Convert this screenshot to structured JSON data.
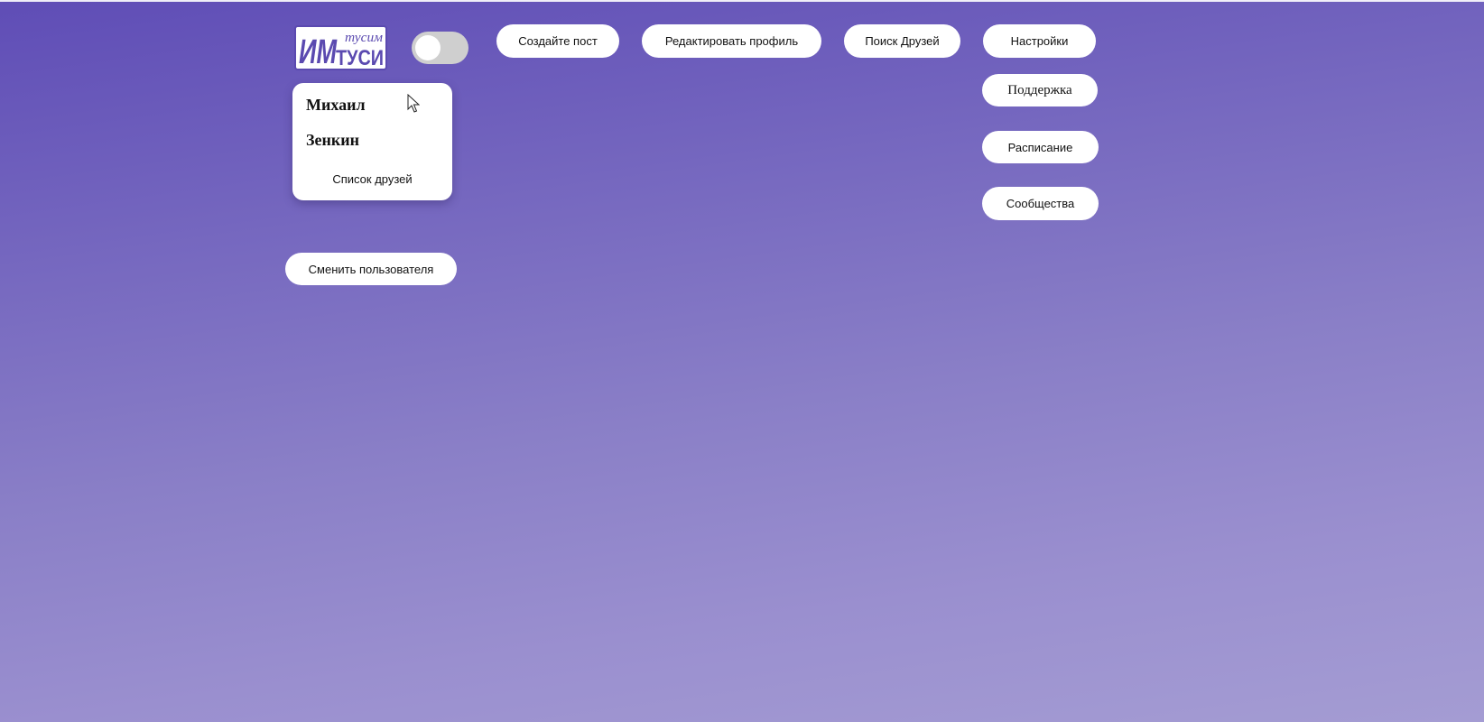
{
  "logo": {
    "main_text": "ТУСИ",
    "sub_text": "тусим",
    "monogram": "ИМ"
  },
  "theme_toggle": {
    "state": "off"
  },
  "header": {
    "create_post": "Создайте пост",
    "edit_profile": "Редактировать профиль",
    "find_friends": "Поиск Друзей",
    "settings": "Настройки"
  },
  "right_menu": {
    "support": "Поддержка",
    "schedule": "Расписание",
    "communities": "Сообщества"
  },
  "profile": {
    "first_name": "Михаил",
    "last_name": "Зенкин",
    "friends_list": "Список друзей"
  },
  "switch_user": "Сменить пользователя",
  "colors": {
    "background_top": "#5f4db6",
    "background_bottom": "#a49cd3",
    "logo_purple": "#5b4ab0",
    "button_bg": "#ffffff"
  }
}
